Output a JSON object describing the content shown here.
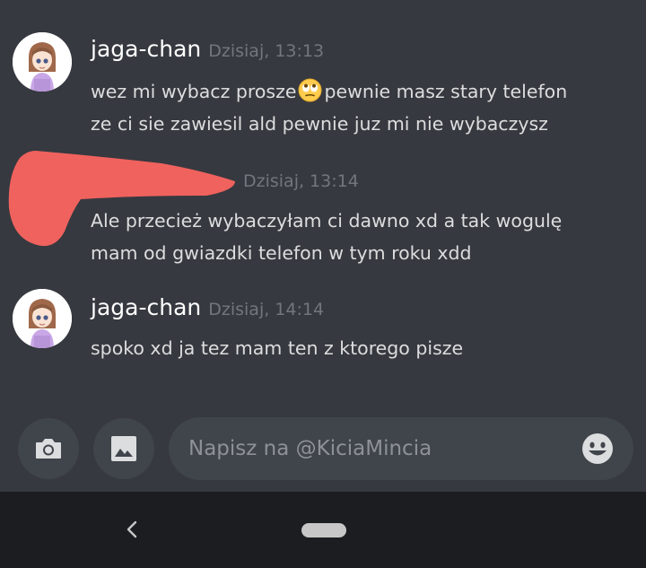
{
  "messages": [
    {
      "username": "jaga-chan",
      "timestamp": "Dzisiaj, 13:13",
      "line1_before": "wez mi wybacz prosze",
      "line1_emoji": "face-with-rolling-eyes-emoji",
      "line1_after": "pewnie masz stary telefon",
      "line2": "ze ci sie zawiesil ald pewnie juz  mi nie wybaczysz"
    },
    {
      "username": "",
      "timestamp": "Dzisiaj, 13:14",
      "line1": "Ale przecież wybaczyłam ci dawno xd a tak wogulę",
      "line2": "mam od gwiazdki telefon w tym roku xdd"
    },
    {
      "username": "jaga-chan",
      "timestamp": "Dzisiaj, 14:14",
      "line1": "spoko xd ja tez mam ten z ktorego pisze"
    }
  ],
  "composer": {
    "placeholder": "Napisz na @KiciaMincia",
    "camera_icon": "camera-icon",
    "image_icon": "image-icon",
    "emoji_icon": "emoji-icon"
  },
  "nav": {
    "back_icon": "chevron-left-icon",
    "home_icon": "home-pill-icon"
  },
  "colors": {
    "background": "#36393f",
    "input_background": "#40444b",
    "username": "#ffffff",
    "timestamp": "#72767d",
    "message_text": "#dcddde",
    "scribble": "#f0625e",
    "navbar": "#1c1d20"
  }
}
